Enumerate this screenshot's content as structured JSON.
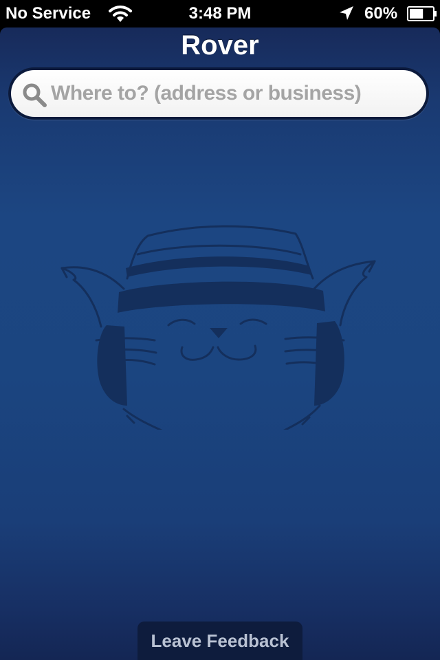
{
  "status_bar": {
    "carrier": "No Service",
    "time": "3:48 PM",
    "battery_percent": "60%",
    "battery_level": 0.6,
    "icons": [
      "wifi-icon",
      "location-arrow-icon",
      "battery-icon"
    ]
  },
  "app": {
    "title": "Rover",
    "search": {
      "placeholder": "Where to? (address or business)",
      "value": "",
      "icon": "search-icon"
    },
    "mascot": "cat-with-headphones-logo",
    "feedback_label": "Leave Feedback"
  },
  "colors": {
    "background": "#1c4682",
    "mascot_ink": "#142f5c",
    "feedback_tab": "#0e1c3d",
    "placeholder_text": "#a4a4a4"
  }
}
